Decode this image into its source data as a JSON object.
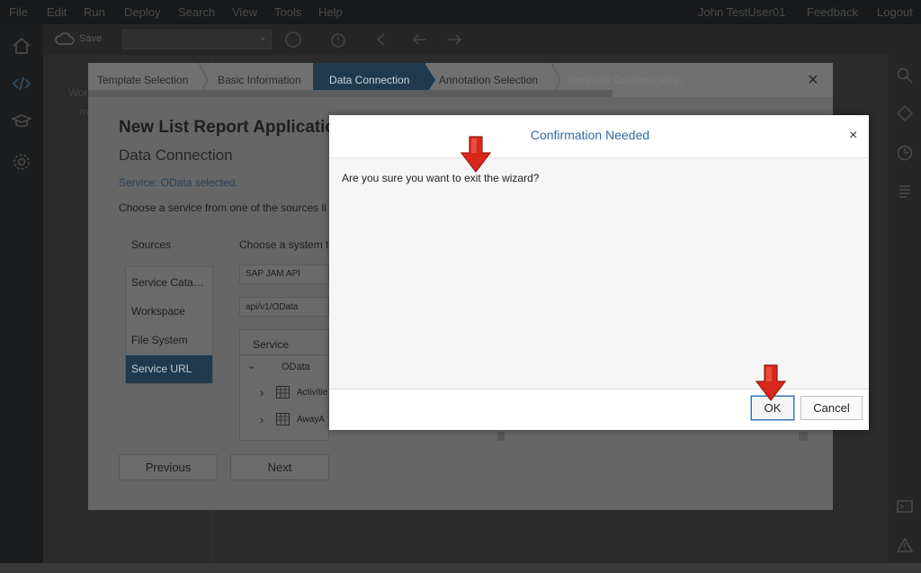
{
  "menubar": {
    "items": [
      "File",
      "Edit",
      "Run",
      "Deploy",
      "Search",
      "View",
      "Tools",
      "Help"
    ],
    "user": "John TestUser01",
    "feedback": "Feedback",
    "logout": "Logout"
  },
  "toolbar": {
    "save_label": "Save"
  },
  "workspace": {
    "tree_root": "Wor",
    "tree_child": "m"
  },
  "wizard": {
    "steps": [
      "Template Selection",
      "Basic Information",
      "Data Connection",
      "Annotation Selection",
      "Template Customization"
    ],
    "active_step": "Data Connection",
    "title": "New List Report Applicatio",
    "subtitle": "Data Connection",
    "status": "Service: OData selected.",
    "instruction": "Choose a service from one of the sources li",
    "sources_label": "Sources",
    "sources": [
      "Service Cata…",
      "Workspace",
      "File System",
      "Service URL"
    ],
    "selected_source": "Service URL",
    "system_label": "Choose a system t",
    "system_value": "SAP JAM API",
    "path_value": "api/v1/OData",
    "table_header": "Service",
    "tree_rows": [
      "OData",
      "Activitie",
      "AwayA"
    ],
    "previous_label": "Previous",
    "next_label": "Next"
  },
  "dialog": {
    "title": "Confirmation Needed",
    "message": "Are you sure you want to exit the wizard?",
    "ok_label": "OK",
    "cancel_label": "Cancel",
    "close_glyph": "×"
  },
  "colors": {
    "accent_blue": "#2e6aa5",
    "active_step": "#1f3a4e",
    "arrow_red": "#d9281a"
  }
}
